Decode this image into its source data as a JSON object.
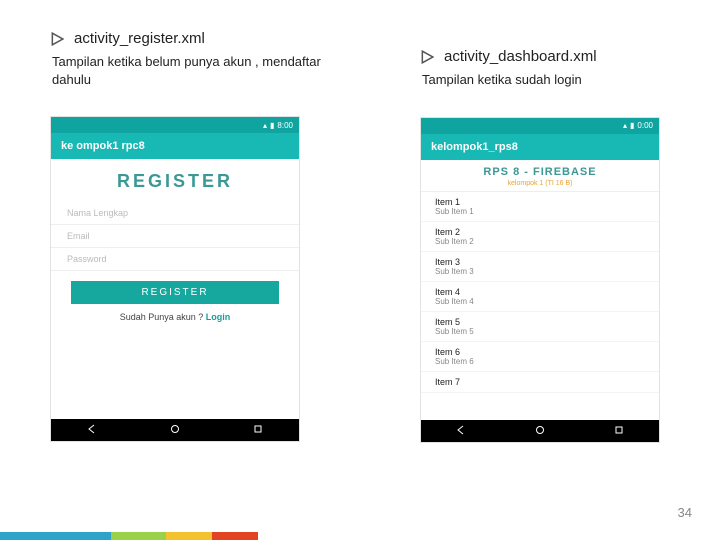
{
  "left": {
    "file": "activity_register.xml",
    "desc": "Tampilan ketika belum punya akun , mendaftar dahulu",
    "statusbar_time": "8:00",
    "appbar": "ke ompok1 rpc8",
    "title": "REGISTER",
    "field_name": "Nama Lengkap",
    "field_email": "Email",
    "field_password": "Password",
    "btn": "REGISTER",
    "have_account": "Sudah Punya akun ?",
    "login": "Login"
  },
  "right": {
    "file": "activity_dashboard.xml",
    "desc": "Tampilan ketika  sudah login",
    "statusbar_time": "0:00",
    "appbar": "kelompok1_rps8",
    "banner_title": "RPS 8 - FIREBASE",
    "banner_sub": "kelompok 1 (TI 16 B)",
    "items": [
      {
        "t1": "Item 1",
        "t2": "Sub Item 1"
      },
      {
        "t1": "Item 2",
        "t2": "Sub Item 2"
      },
      {
        "t1": "Item 3",
        "t2": "Sub Item 3"
      },
      {
        "t1": "Item 4",
        "t2": "Sub Item 4"
      },
      {
        "t1": "Item 5",
        "t2": "Sub Item 5"
      },
      {
        "t1": "Item 6",
        "t2": "Sub Item 6"
      },
      {
        "t1": "Item 7",
        "t2": ""
      }
    ]
  },
  "page_number": "34"
}
